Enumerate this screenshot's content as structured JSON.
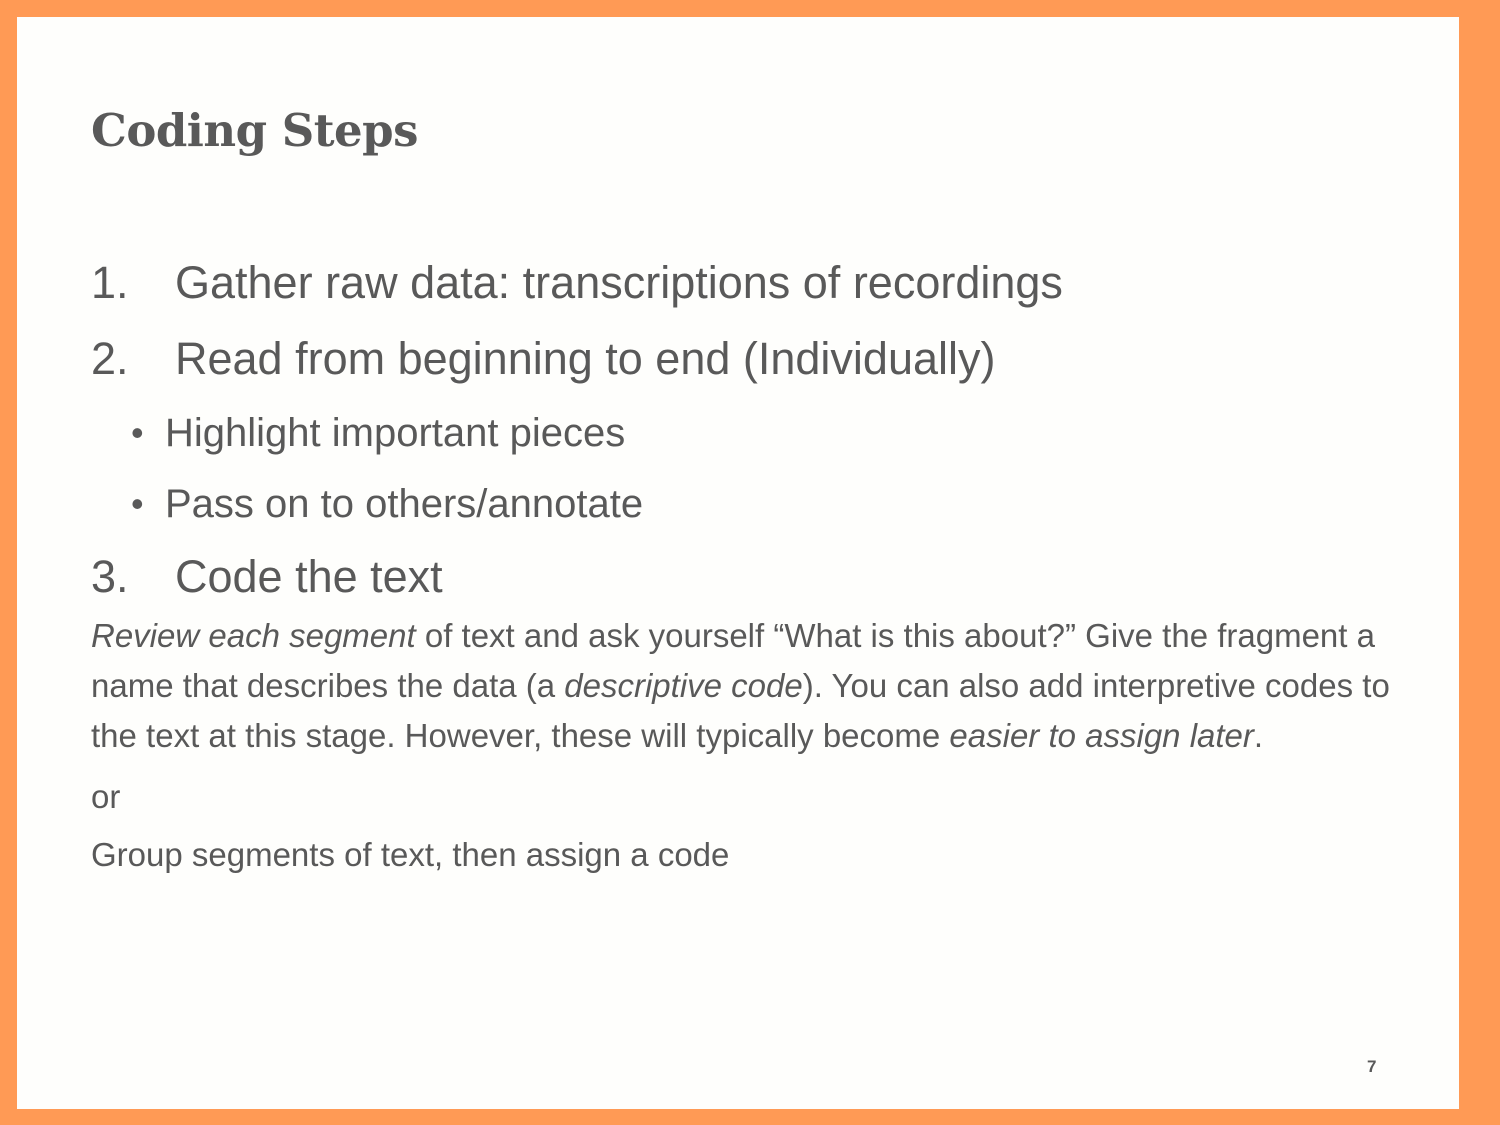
{
  "slide": {
    "title": "Coding Steps",
    "steps": [
      {
        "num": "1.",
        "text": "Gather raw data: transcriptions of recordings"
      },
      {
        "num": "2.",
        "text": "Read from beginning to end (Individually)"
      }
    ],
    "sub_bullets": [
      {
        "marker": "•",
        "text": "Highlight important pieces"
      },
      {
        "marker": "•",
        "text": "Pass on to others/annotate"
      }
    ],
    "step3": {
      "num": "3.",
      "text": "Code the text"
    },
    "paragraph": {
      "p1_em": "Review each segment",
      "p1": " of text and ask yourself “What is this about?” Give the fragment a name that describes the data (a ",
      "p2_em": "descriptive code",
      "p2": "). You can also add interpretive codes to the text at this stage. However, these will typically become ",
      "p3_em": "easier to assign later",
      "p3": "."
    },
    "or_text": "or",
    "group_text": "Group segments of text, then assign a code",
    "page_number": "7"
  }
}
